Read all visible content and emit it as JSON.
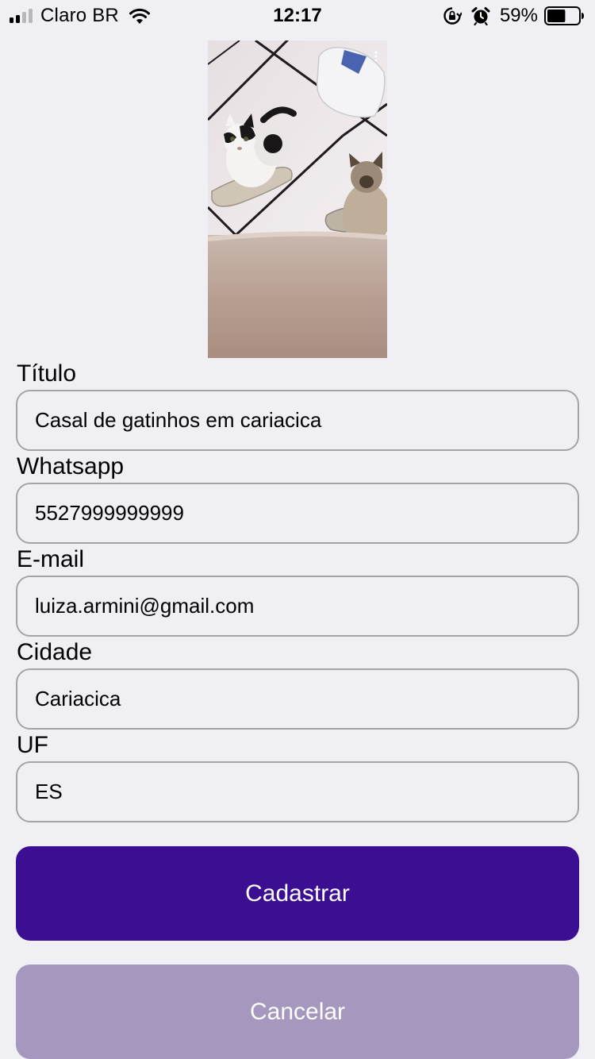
{
  "status_bar": {
    "carrier": "Claro BR",
    "time": "12:17",
    "battery_percent": "59%",
    "battery_level": 0.59,
    "signal_bars_filled": 2,
    "icons": [
      "signal-bars-icon",
      "wifi-icon",
      "rotation-lock-icon",
      "alarm-clock-icon",
      "battery-icon"
    ]
  },
  "photo": {
    "subject": "two kittens on a tiled floor"
  },
  "form": {
    "titulo": {
      "label": "Título",
      "value": "Casal de gatinhos em cariacica"
    },
    "whatsapp": {
      "label": "Whatsapp",
      "value": "5527999999999"
    },
    "email": {
      "label": "E-mail",
      "value": "luiza.armini@gmail.com"
    },
    "cidade": {
      "label": "Cidade",
      "value": "Cariacica"
    },
    "uf": {
      "label": "UF",
      "value": "ES"
    }
  },
  "actions": {
    "submit_label": "Cadastrar",
    "cancel_label": "Cancelar"
  },
  "colors": {
    "background": "#efeff4",
    "primary": "#3b0e92",
    "secondary": "#a597bd",
    "input_border": "#a3a3a8"
  }
}
